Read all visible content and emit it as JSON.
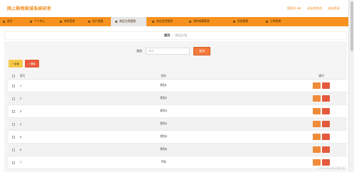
{
  "header": {
    "site_title": "网上购物商城系统研发",
    "links": [
      "管理员 abc",
      "退出到前台",
      "退出登录"
    ]
  },
  "nav": {
    "items": [
      {
        "label": "首页",
        "active": false
      },
      {
        "label": "个人中心",
        "active": false
      },
      {
        "label": "商家管理",
        "active": false
      },
      {
        "label": "用户管理",
        "active": false
      },
      {
        "label": "商品分类管理",
        "active": true
      },
      {
        "label": "商品信息管理",
        "active": false
      },
      {
        "label": "我的收藏管理",
        "active": false
      },
      {
        "label": "系统管理",
        "active": false
      },
      {
        "label": "订单管理",
        "active": false
      }
    ]
  },
  "breadcrumb": {
    "home": "首页",
    "separator": "/",
    "current": "商品分类"
  },
  "search": {
    "label": "类别",
    "placeholder": "类别",
    "button": "查询"
  },
  "actions": {
    "add": "+ 新增",
    "delete": "× 删除"
  },
  "table": {
    "headers": {
      "index": "索引",
      "category": "类别",
      "ops": "操作"
    },
    "rows": [
      {
        "index": "1",
        "category": "类别1"
      },
      {
        "index": "2",
        "category": "类别2"
      },
      {
        "index": "3",
        "category": "类别3"
      },
      {
        "index": "4",
        "category": "类别4"
      },
      {
        "index": "5",
        "category": "类别5"
      },
      {
        "index": "6",
        "category": "类别6"
      },
      {
        "index": "7",
        "category": "手机"
      }
    ]
  },
  "watermark": "CSDN @小林子爱好者",
  "colors": {
    "nav_bg": "#f7921e",
    "title": "#f08c1e",
    "search_button": "#f37a3c",
    "add_button": "#f6c94a",
    "delete_button": "#ea5a3c"
  }
}
